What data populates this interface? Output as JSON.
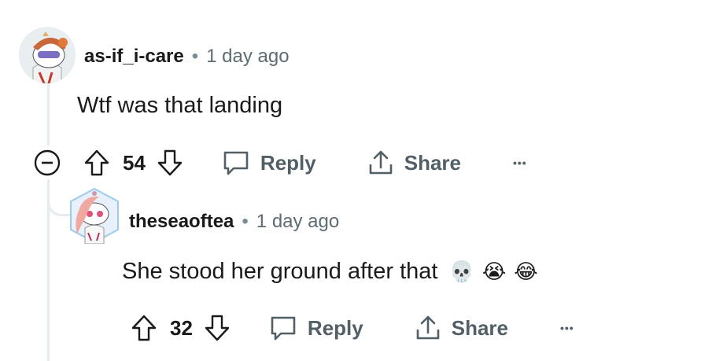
{
  "comment": {
    "username": "as-if_i-care",
    "separator": "•",
    "time": "1 day ago",
    "body": "Wtf was that landing",
    "votes": "54",
    "reply_label": "Reply",
    "share_label": "Share",
    "more_label": "•••",
    "collapse_label": "−"
  },
  "reply": {
    "username": "theseaoftea",
    "separator": "•",
    "time": "1 day ago",
    "body": "She stood her ground after that",
    "emojis": [
      "💀",
      "😭",
      "😂"
    ],
    "votes": "32",
    "reply_label": "Reply",
    "share_label": "Share",
    "more_label": "•••"
  }
}
